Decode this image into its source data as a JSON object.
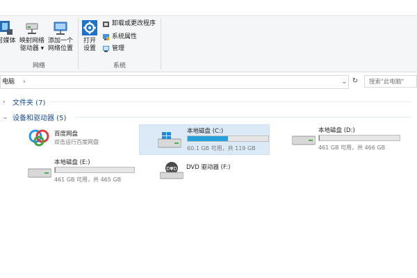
{
  "ribbon": {
    "network": {
      "group_label": "网络",
      "media": "可媒体",
      "map_drive": [
        "映射网络",
        "驱动器"
      ],
      "add_location": [
        "添加一个",
        "网络位置"
      ]
    },
    "system": {
      "group_label": "系统",
      "open_settings": [
        "打开",
        "设置"
      ],
      "uninstall": "卸载或更改程序",
      "sys_props": "系统属性",
      "manage": "管理"
    }
  },
  "address": {
    "path": "电脑",
    "search_placeholder": "搜索\"此电脑\""
  },
  "sections": {
    "folders": "文件夹 (7)",
    "devices": "设备和驱动器 (5)"
  },
  "drives": [
    {
      "name": "百度网盘",
      "subtitle": "双击运行百度网盘",
      "icon": "baidu-netdisk-icon"
    },
    {
      "name": "本地磁盘 (C:)",
      "subtitle": "60.1 GB 可用，共 119 GB",
      "fill": 0.5,
      "icon": "windows-drive-icon",
      "selected": true
    },
    {
      "name": "本地磁盘 (D:)",
      "subtitle": "461 GB 可用，共 466 GB",
      "fill": 0.01,
      "icon": "hard-drive-icon"
    },
    {
      "name": "本地磁盘 (E:)",
      "subtitle": "461 GB 可用，共 465 GB",
      "fill": 0.01,
      "icon": "hard-drive-icon"
    },
    {
      "name": "DVD 驱动器 (F:)",
      "icon": "dvd-drive-icon"
    }
  ],
  "colors": {
    "accent": "#26a0da",
    "selection": "#dceaf7",
    "section_text": "#1a4e8e"
  }
}
